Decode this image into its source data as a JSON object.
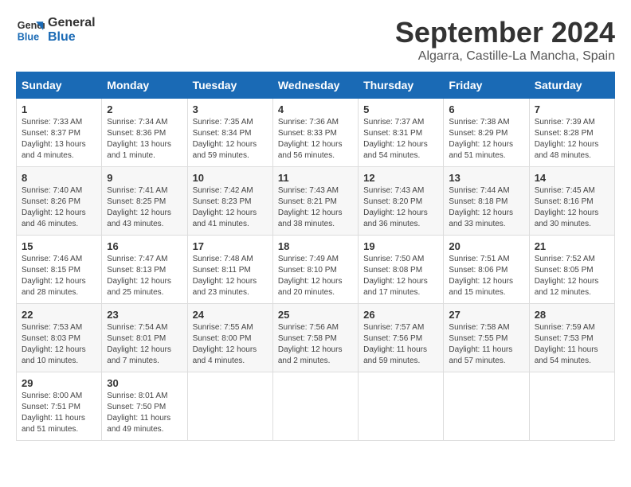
{
  "logo": {
    "line1": "General",
    "line2": "Blue"
  },
  "title": "September 2024",
  "location": "Algarra, Castille-La Mancha, Spain",
  "headers": [
    "Sunday",
    "Monday",
    "Tuesday",
    "Wednesday",
    "Thursday",
    "Friday",
    "Saturday"
  ],
  "weeks": [
    [
      {
        "day": "1",
        "info": "Sunrise: 7:33 AM\nSunset: 8:37 PM\nDaylight: 13 hours\nand 4 minutes."
      },
      {
        "day": "2",
        "info": "Sunrise: 7:34 AM\nSunset: 8:36 PM\nDaylight: 13 hours\nand 1 minute."
      },
      {
        "day": "3",
        "info": "Sunrise: 7:35 AM\nSunset: 8:34 PM\nDaylight: 12 hours\nand 59 minutes."
      },
      {
        "day": "4",
        "info": "Sunrise: 7:36 AM\nSunset: 8:33 PM\nDaylight: 12 hours\nand 56 minutes."
      },
      {
        "day": "5",
        "info": "Sunrise: 7:37 AM\nSunset: 8:31 PM\nDaylight: 12 hours\nand 54 minutes."
      },
      {
        "day": "6",
        "info": "Sunrise: 7:38 AM\nSunset: 8:29 PM\nDaylight: 12 hours\nand 51 minutes."
      },
      {
        "day": "7",
        "info": "Sunrise: 7:39 AM\nSunset: 8:28 PM\nDaylight: 12 hours\nand 48 minutes."
      }
    ],
    [
      {
        "day": "8",
        "info": "Sunrise: 7:40 AM\nSunset: 8:26 PM\nDaylight: 12 hours\nand 46 minutes."
      },
      {
        "day": "9",
        "info": "Sunrise: 7:41 AM\nSunset: 8:25 PM\nDaylight: 12 hours\nand 43 minutes."
      },
      {
        "day": "10",
        "info": "Sunrise: 7:42 AM\nSunset: 8:23 PM\nDaylight: 12 hours\nand 41 minutes."
      },
      {
        "day": "11",
        "info": "Sunrise: 7:43 AM\nSunset: 8:21 PM\nDaylight: 12 hours\nand 38 minutes."
      },
      {
        "day": "12",
        "info": "Sunrise: 7:43 AM\nSunset: 8:20 PM\nDaylight: 12 hours\nand 36 minutes."
      },
      {
        "day": "13",
        "info": "Sunrise: 7:44 AM\nSunset: 8:18 PM\nDaylight: 12 hours\nand 33 minutes."
      },
      {
        "day": "14",
        "info": "Sunrise: 7:45 AM\nSunset: 8:16 PM\nDaylight: 12 hours\nand 30 minutes."
      }
    ],
    [
      {
        "day": "15",
        "info": "Sunrise: 7:46 AM\nSunset: 8:15 PM\nDaylight: 12 hours\nand 28 minutes."
      },
      {
        "day": "16",
        "info": "Sunrise: 7:47 AM\nSunset: 8:13 PM\nDaylight: 12 hours\nand 25 minutes."
      },
      {
        "day": "17",
        "info": "Sunrise: 7:48 AM\nSunset: 8:11 PM\nDaylight: 12 hours\nand 23 minutes."
      },
      {
        "day": "18",
        "info": "Sunrise: 7:49 AM\nSunset: 8:10 PM\nDaylight: 12 hours\nand 20 minutes."
      },
      {
        "day": "19",
        "info": "Sunrise: 7:50 AM\nSunset: 8:08 PM\nDaylight: 12 hours\nand 17 minutes."
      },
      {
        "day": "20",
        "info": "Sunrise: 7:51 AM\nSunset: 8:06 PM\nDaylight: 12 hours\nand 15 minutes."
      },
      {
        "day": "21",
        "info": "Sunrise: 7:52 AM\nSunset: 8:05 PM\nDaylight: 12 hours\nand 12 minutes."
      }
    ],
    [
      {
        "day": "22",
        "info": "Sunrise: 7:53 AM\nSunset: 8:03 PM\nDaylight: 12 hours\nand 10 minutes."
      },
      {
        "day": "23",
        "info": "Sunrise: 7:54 AM\nSunset: 8:01 PM\nDaylight: 12 hours\nand 7 minutes."
      },
      {
        "day": "24",
        "info": "Sunrise: 7:55 AM\nSunset: 8:00 PM\nDaylight: 12 hours\nand 4 minutes."
      },
      {
        "day": "25",
        "info": "Sunrise: 7:56 AM\nSunset: 7:58 PM\nDaylight: 12 hours\nand 2 minutes."
      },
      {
        "day": "26",
        "info": "Sunrise: 7:57 AM\nSunset: 7:56 PM\nDaylight: 11 hours\nand 59 minutes."
      },
      {
        "day": "27",
        "info": "Sunrise: 7:58 AM\nSunset: 7:55 PM\nDaylight: 11 hours\nand 57 minutes."
      },
      {
        "day": "28",
        "info": "Sunrise: 7:59 AM\nSunset: 7:53 PM\nDaylight: 11 hours\nand 54 minutes."
      }
    ],
    [
      {
        "day": "29",
        "info": "Sunrise: 8:00 AM\nSunset: 7:51 PM\nDaylight: 11 hours\nand 51 minutes."
      },
      {
        "day": "30",
        "info": "Sunrise: 8:01 AM\nSunset: 7:50 PM\nDaylight: 11 hours\nand 49 minutes."
      },
      {
        "day": "",
        "info": ""
      },
      {
        "day": "",
        "info": ""
      },
      {
        "day": "",
        "info": ""
      },
      {
        "day": "",
        "info": ""
      },
      {
        "day": "",
        "info": ""
      }
    ]
  ]
}
